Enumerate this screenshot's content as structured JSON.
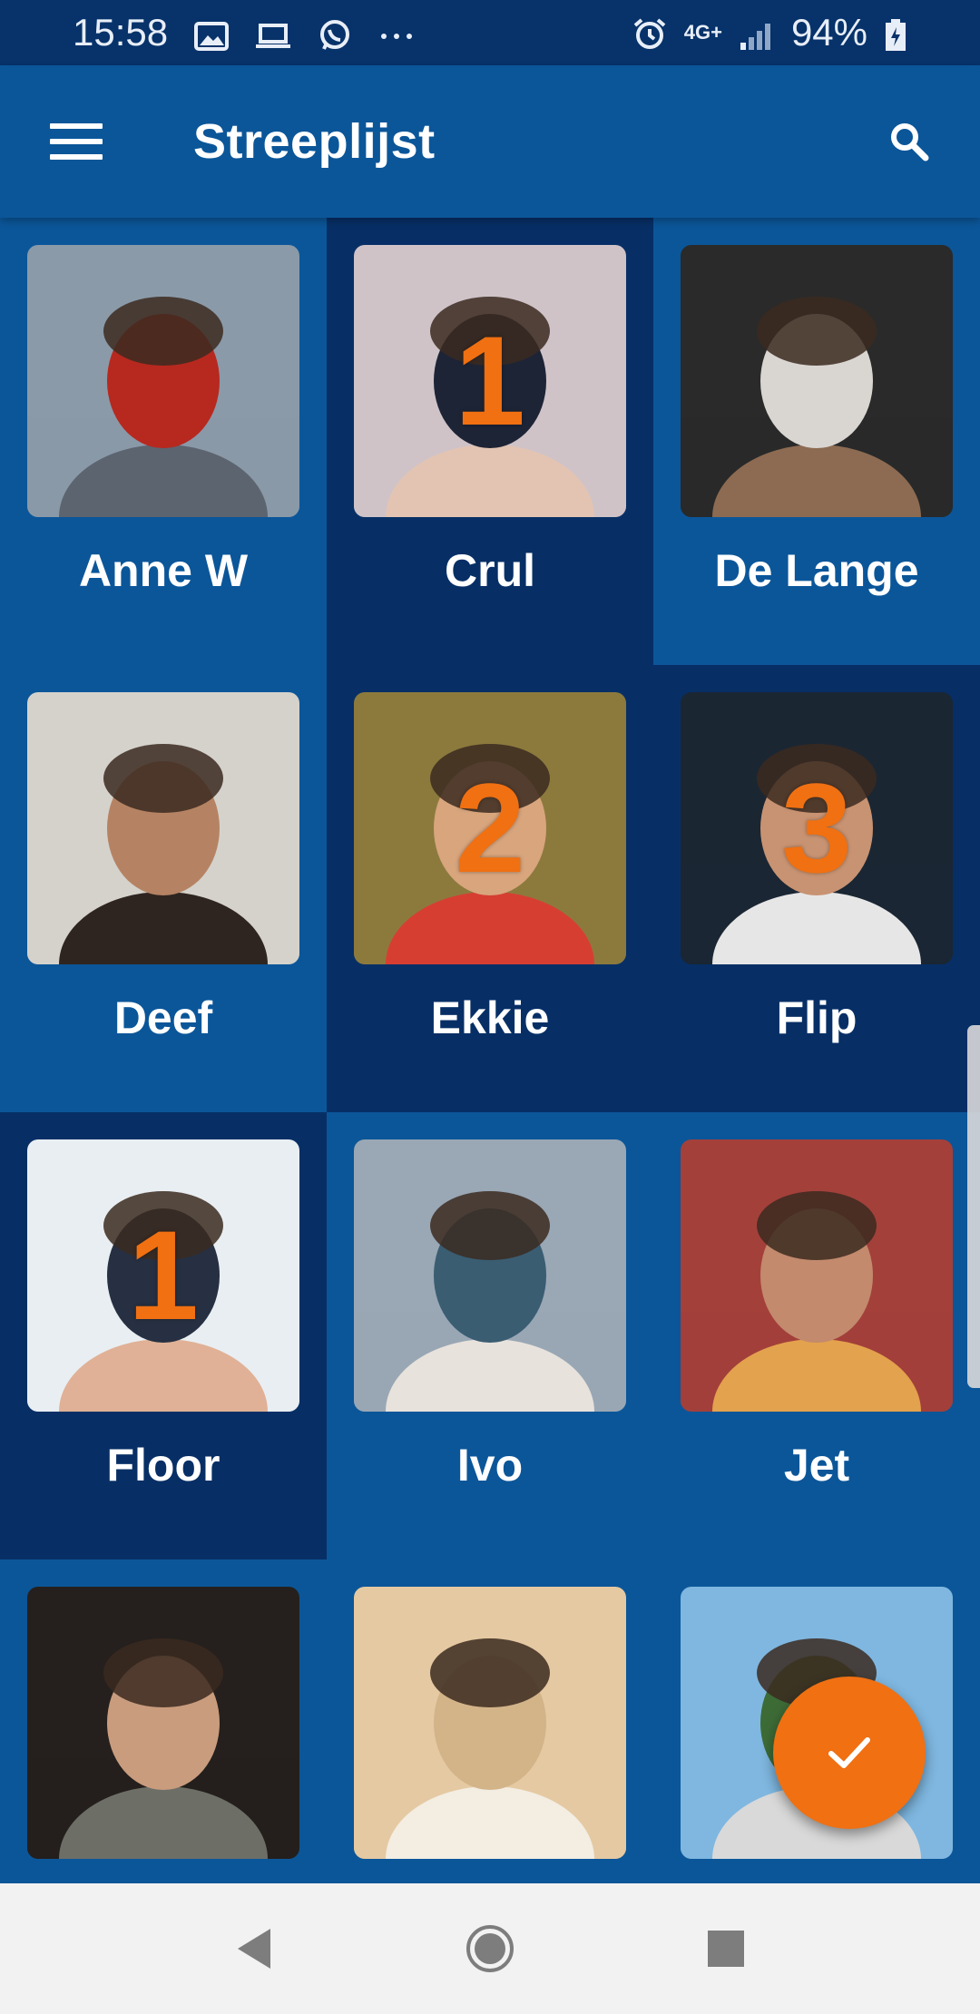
{
  "status_bar": {
    "time": "15:58",
    "battery": "94%",
    "network": "4G+",
    "icons": [
      "image-icon",
      "laptop-icon",
      "whatsapp-icon",
      "more-dots-icon",
      "alarm-icon",
      "signal-icon",
      "battery-icon"
    ]
  },
  "app_bar": {
    "title": "Streeplijst",
    "menu_icon": "hamburger-menu-icon",
    "search_icon": "search-icon"
  },
  "people": [
    {
      "name": "Anne W",
      "count": "",
      "selected": false
    },
    {
      "name": "Crul",
      "count": "1",
      "selected": true
    },
    {
      "name": "De Lange",
      "count": "",
      "selected": false
    },
    {
      "name": "Deef",
      "count": "",
      "selected": false
    },
    {
      "name": "Ekkie",
      "count": "2",
      "selected": true
    },
    {
      "name": "Flip",
      "count": "3",
      "selected": true
    },
    {
      "name": "Floor",
      "count": "1",
      "selected": true
    },
    {
      "name": "Ivo",
      "count": "",
      "selected": false
    },
    {
      "name": "Jet",
      "count": "",
      "selected": false
    },
    {
      "name": "",
      "count": "",
      "selected": false
    },
    {
      "name": "",
      "count": "",
      "selected": false
    },
    {
      "name": "",
      "count": "",
      "selected": false
    }
  ],
  "fab": {
    "icon": "checkmark-icon"
  },
  "nav_bar": {
    "icons": [
      "back-triangle-icon",
      "home-circle-icon",
      "recents-square-icon"
    ]
  },
  "colors": {
    "primary": "#0B5699",
    "primary_dark": "#072F66",
    "status_bar": "#07326A",
    "accent": "#F07012"
  }
}
